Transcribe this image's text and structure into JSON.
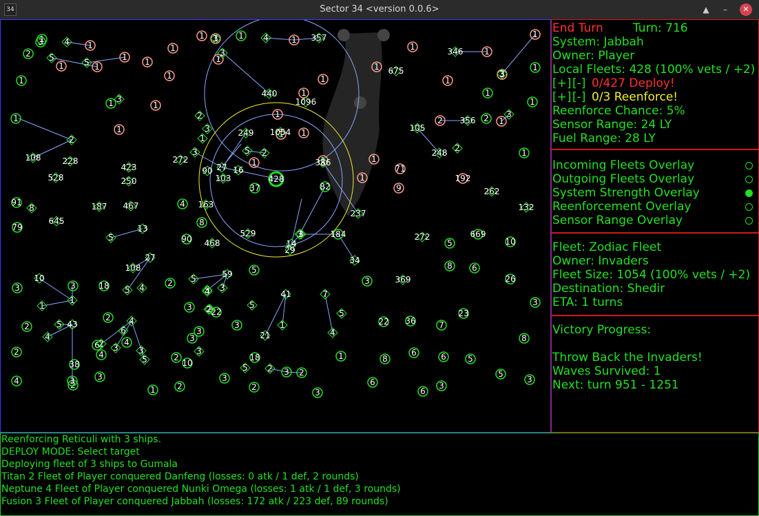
{
  "window": {
    "app_icon": "34",
    "title": "Sector 34   <version 0.0.6>"
  },
  "system": {
    "end_turn": "End Turn",
    "turn": "Turn: 716",
    "name": "System: Jabbah",
    "owner": "Owner: Player",
    "local_fleets": "Local Fleets: 428 (100% vets / +2)",
    "deploy_plus": "[+]",
    "deploy_minus": "[-]",
    "deploy": "0/427 Deploy!",
    "reenforce_plus": "[+]",
    "reenforce_minus": "[-]",
    "reenforce": "0/3 Reenforce!",
    "reenforce_chance": "Reenforce Chance: 5%",
    "sensor_range": "Sensor Range: 24 LY",
    "fuel_range": "Fuel Range: 28 LY"
  },
  "overlays": [
    {
      "label": "Incoming Fleets Overlay",
      "enabled": false
    },
    {
      "label": "Outgoing Fleets Overlay",
      "enabled": false
    },
    {
      "label": "System Strength Overlay",
      "enabled": true
    },
    {
      "label": "Reenforcement Overlay",
      "enabled": false
    },
    {
      "label": "Sensor Range Overlay",
      "enabled": false
    }
  ],
  "fleet": {
    "name": "Fleet: Zodiac Fleet",
    "owner": "Owner: Invaders",
    "size": "Fleet Size: 1054 (100% vets / +2)",
    "destination": "Destination: Shedir",
    "eta": "ETA: 1 turns"
  },
  "victory": {
    "title": "Victory Progress:",
    "goal": "Throw Back the Invaders!",
    "waves": "Waves Survived: 1",
    "next": "Next: turn 951 - 1251"
  },
  "log": [
    "Reenforcing Reticuli with 3 ships.",
    "DEPLOY MODE: Select target",
    "Deploying fleet of 3 ships to Gumala",
    "Titan 2 Fleet of Player conquered Danfeng (losses: 0 atk / 1 def, 2 rounds)",
    "Neptune 4 Fleet of Player conquered Nunki Omega (losses: 1 atk / 1 def, 3 rounds)",
    "Fusion 3 Fleet of Player conquered Jabbah (losses: 172 atk / 223 def, 89 rounds)"
  ],
  "colors": {
    "player": "#22e022",
    "invaders": "#ff9a8a",
    "fleet_lines": "#8aa8ff",
    "sensor_ring": "#f0f030",
    "map_border": "#3a3aff",
    "panel_border": "#d01818"
  },
  "map": {
    "systems": [
      [
        "1",
        "p"
      ],
      [
        "2",
        "p"
      ],
      [
        "1",
        "p"
      ],
      [
        "1",
        "p"
      ],
      [
        "3",
        "p"
      ],
      [
        "1",
        "p"
      ],
      [
        "1",
        "p"
      ],
      [
        "1",
        "p"
      ],
      [
        "2",
        "p"
      ],
      [
        "1",
        "p"
      ],
      [
        "1",
        "p"
      ],
      [
        "1",
        "p"
      ],
      [
        "91",
        "p"
      ],
      [
        "79",
        "p"
      ],
      [
        "4",
        "p"
      ],
      [
        "8",
        "p"
      ],
      [
        "90",
        "p"
      ],
      [
        "37",
        "p"
      ],
      [
        "428",
        "p"
      ],
      [
        "82",
        "p"
      ],
      [
        "184",
        "p"
      ],
      [
        "5",
        "p"
      ],
      [
        "669",
        "p"
      ],
      [
        "10",
        "p"
      ],
      [
        "8",
        "p"
      ],
      [
        "6",
        "p"
      ],
      [
        "3",
        "p"
      ],
      [
        "26",
        "p"
      ],
      [
        "5",
        "p"
      ],
      [
        "3",
        "p"
      ],
      [
        "22",
        "p"
      ],
      [
        "36",
        "p"
      ],
      [
        "7",
        "p"
      ],
      [
        "23",
        "p"
      ],
      [
        "8",
        "p"
      ],
      [
        "1",
        "p"
      ],
      [
        "8",
        "p"
      ],
      [
        "6",
        "p"
      ],
      [
        "6",
        "p"
      ],
      [
        "5",
        "p"
      ],
      [
        "5",
        "p"
      ],
      [
        "6",
        "p"
      ],
      [
        "3",
        "p"
      ],
      [
        "6",
        "p"
      ],
      [
        "3",
        "p"
      ],
      [
        "3",
        "p"
      ],
      [
        "2",
        "p"
      ],
      [
        "3",
        "p"
      ],
      [
        "18",
        "p"
      ],
      [
        "2",
        "p"
      ],
      [
        "3",
        "p"
      ],
      [
        "22",
        "p"
      ],
      [
        "3",
        "p"
      ],
      [
        "2",
        "p"
      ],
      [
        "4",
        "p"
      ],
      [
        "2",
        "p"
      ],
      [
        "3",
        "p"
      ],
      [
        "4",
        "p"
      ],
      [
        "38",
        "p"
      ],
      [
        "4",
        "p"
      ],
      [
        "2",
        "p"
      ],
      [
        "3",
        "p"
      ],
      [
        "3",
        "p"
      ],
      [
        "2",
        "p"
      ],
      [
        "10",
        "p"
      ],
      [
        "18",
        "p"
      ],
      [
        "2",
        "p"
      ],
      [
        "3",
        "p"
      ],
      [
        "2",
        "p"
      ],
      [
        "1",
        "p"
      ],
      [
        "3",
        "p"
      ],
      [
        "2",
        "p"
      ],
      [
        "3",
        "p"
      ],
      [
        "3",
        "p"
      ],
      [
        "6",
        "p"
      ],
      [
        "1",
        "e"
      ],
      [
        "1",
        "e"
      ],
      [
        "1",
        "e"
      ],
      [
        "1",
        "e"
      ],
      [
        "1",
        "e"
      ],
      [
        "1",
        "e"
      ],
      [
        "1",
        "e"
      ],
      [
        "1",
        "e"
      ],
      [
        "1",
        "e"
      ],
      [
        "1",
        "e"
      ],
      [
        "1",
        "e"
      ],
      [
        "1",
        "e"
      ],
      [
        "1",
        "e"
      ],
      [
        "1",
        "e"
      ],
      [
        "1",
        "e"
      ],
      [
        "1",
        "e"
      ],
      [
        "1",
        "e"
      ],
      [
        "1",
        "e"
      ],
      [
        "1",
        "e"
      ],
      [
        "1",
        "e"
      ],
      [
        "1",
        "e"
      ],
      [
        "2",
        "e"
      ],
      [
        "1",
        "e"
      ],
      [
        "1",
        "e"
      ],
      [
        "1",
        "e"
      ],
      [
        "3",
        "e"
      ],
      [
        "1",
        "e"
      ],
      [
        "192",
        "e"
      ],
      [
        "71",
        "e"
      ],
      [
        "9",
        "e"
      ],
      [
        "1",
        "e"
      ],
      [
        "1",
        "e"
      ],
      [
        "1",
        "e"
      ]
    ],
    "fleets": [
      [
        "4"
      ],
      [
        "5"
      ],
      [
        "5"
      ],
      [
        "3"
      ],
      [
        "4"
      ],
      [
        "357"
      ],
      [
        "3"
      ],
      [
        "3"
      ],
      [
        "2"
      ],
      [
        "3"
      ],
      [
        "1"
      ],
      [
        "5"
      ],
      [
        "2"
      ],
      [
        "27"
      ],
      [
        "3"
      ],
      [
        "2"
      ],
      [
        "346"
      ],
      [
        "675"
      ],
      [
        "356"
      ],
      [
        "105"
      ],
      [
        "248"
      ],
      [
        "2"
      ],
      [
        "3"
      ],
      [
        "3"
      ],
      [
        "262"
      ],
      [
        "132"
      ],
      [
        "237"
      ],
      [
        "8"
      ],
      [
        "187"
      ],
      [
        "467"
      ],
      [
        "645"
      ],
      [
        "5"
      ],
      [
        "13"
      ],
      [
        "10"
      ],
      [
        "1"
      ],
      [
        "1"
      ],
      [
        "108"
      ],
      [
        "27"
      ],
      [
        "5"
      ],
      [
        "4"
      ],
      [
        "5"
      ],
      [
        "5"
      ],
      [
        "59"
      ],
      [
        "4"
      ],
      [
        "3"
      ],
      [
        "2"
      ],
      [
        "41"
      ],
      [
        "5"
      ],
      [
        "1"
      ],
      [
        "21"
      ],
      [
        "7"
      ],
      [
        "4"
      ],
      [
        "5"
      ],
      [
        "5"
      ],
      [
        "4"
      ],
      [
        "43"
      ],
      [
        "4"
      ],
      [
        "6"
      ],
      [
        "2"
      ],
      [
        "3"
      ],
      [
        "3"
      ],
      [
        "5"
      ],
      [
        "3"
      ],
      [
        "2"
      ],
      [
        "2"
      ],
      [
        "5"
      ],
      [
        "34"
      ],
      [
        "3"
      ],
      [
        "14"
      ],
      [
        "369"
      ],
      [
        "272"
      ],
      [
        "468"
      ],
      [
        "529"
      ],
      [
        "163"
      ],
      [
        "250"
      ],
      [
        "423"
      ],
      [
        "528"
      ],
      [
        "228"
      ],
      [
        "108"
      ],
      [
        "272"
      ],
      [
        "90"
      ],
      [
        "103"
      ],
      [
        "16"
      ],
      [
        "249"
      ],
      [
        "1054"
      ],
      [
        "440"
      ],
      [
        "1096"
      ],
      [
        "386"
      ],
      [
        "29"
      ],
      [
        "3"
      ]
    ]
  }
}
